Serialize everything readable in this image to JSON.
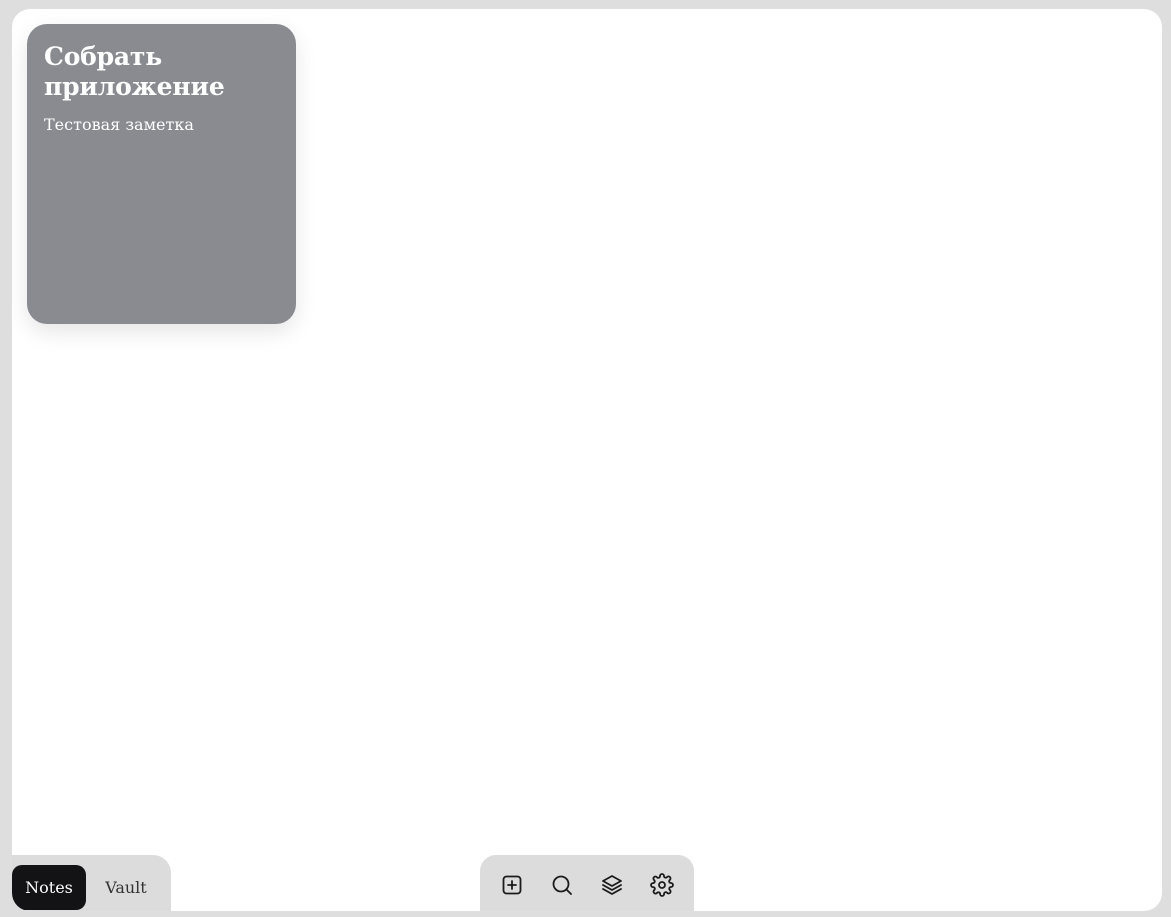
{
  "notes": [
    {
      "title": "Собрать приложение",
      "body": "Тестовая заметка",
      "color": "#8a8b91"
    }
  ],
  "mode_switch": {
    "tabs": [
      {
        "label": "Notes",
        "active": true
      },
      {
        "label": "Vault",
        "active": false
      }
    ]
  },
  "toolbar": {
    "buttons": [
      {
        "icon": "plus-square-icon"
      },
      {
        "icon": "search-icon"
      },
      {
        "icon": "layers-icon"
      },
      {
        "icon": "gear-icon"
      }
    ]
  },
  "colors": {
    "background": "#dedede",
    "canvas": "#ffffff",
    "active_tab": "#131316",
    "panel": "#dcdcdc"
  }
}
